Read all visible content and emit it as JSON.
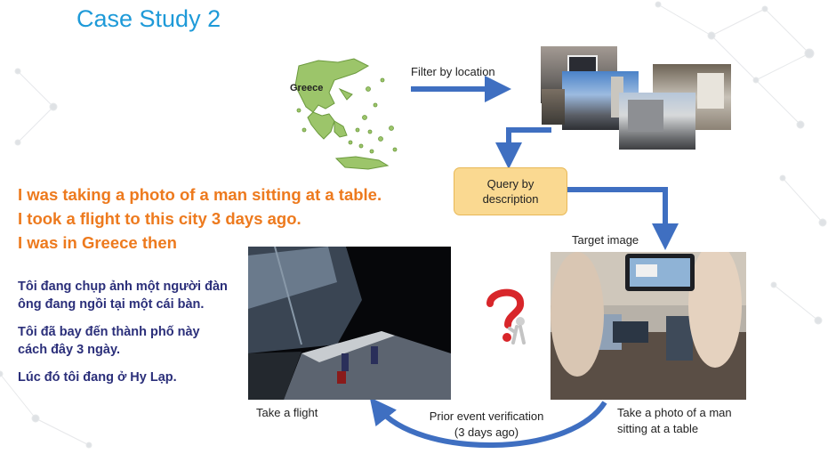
{
  "slide": {
    "title": "Case Study 2"
  },
  "map": {
    "label": "Greece"
  },
  "flow": {
    "filter_label": "Filter by location",
    "query_label": "Query by\ndescription",
    "target_label": "Target image",
    "prior_label": "Prior event verification\n(3 days ago)"
  },
  "english": {
    "lines": [
      "I was taking a photo of a man sitting at a table.",
      "I took a flight to this city 3 days ago.",
      "I was in Greece then"
    ]
  },
  "vietnamese": {
    "p1": "Tôi đang chụp ảnh một người đàn ông đang ngồi tại một cái bàn.",
    "p2": "Tôi đã bay đến thành phố này cách đây 3 ngày.",
    "p3": "Lúc đó tôi đang ở Hy Lạp."
  },
  "captions": {
    "flight": "Take a flight",
    "target": "Take a photo of a man\nsitting at a table"
  },
  "colors": {
    "title": "#1e9ad8",
    "english_text": "#ed7a1e",
    "vietnamese_text": "#2b2f7a",
    "arrow": "#3f6fc1",
    "query_box": "#fad991",
    "map_fill": "#9cc56a"
  },
  "icons": {
    "question": "question-mark-figure-icon"
  }
}
